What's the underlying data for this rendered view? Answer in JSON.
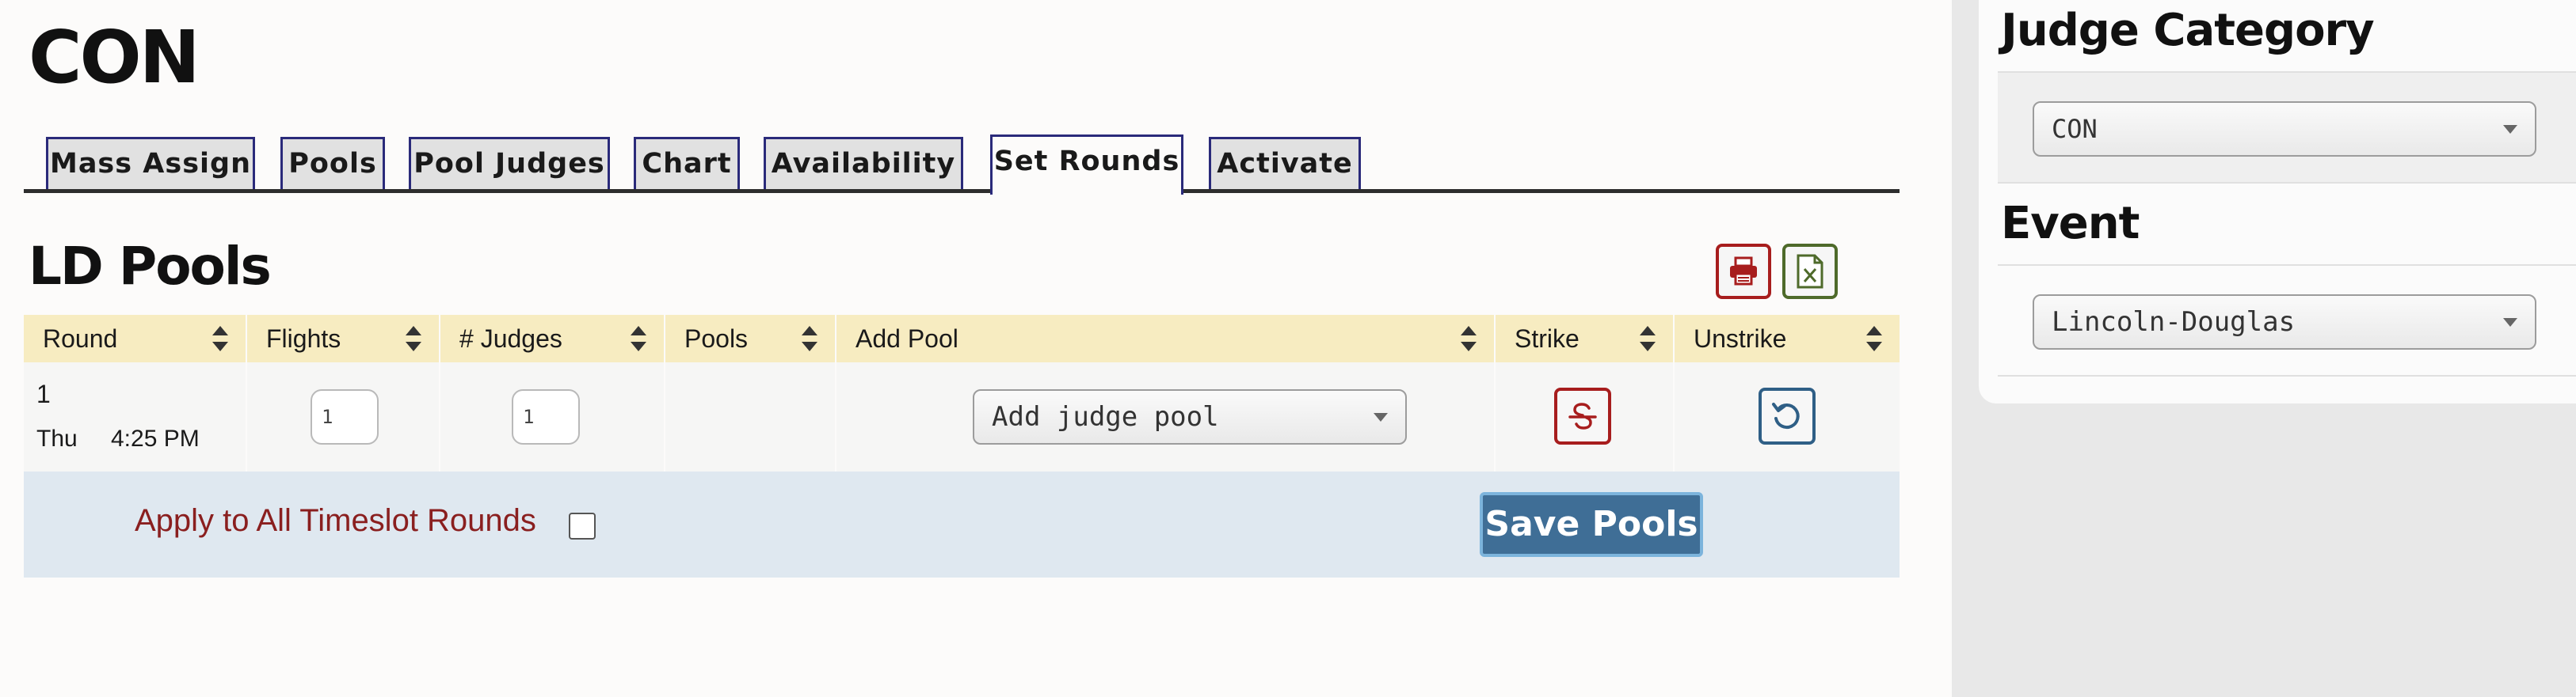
{
  "page": {
    "title": "CON"
  },
  "tabs": [
    {
      "label": "Mass Assign",
      "active": false
    },
    {
      "label": "Pools",
      "active": false
    },
    {
      "label": "Pool Judges",
      "active": false
    },
    {
      "label": "Chart",
      "active": false
    },
    {
      "label": "Availability",
      "active": false
    },
    {
      "label": "Set Rounds",
      "active": true
    },
    {
      "label": "Activate",
      "active": false
    }
  ],
  "section": {
    "title": "LD Pools",
    "actions": {
      "print_icon": "printer-icon",
      "excel_icon": "excel-file-icon"
    }
  },
  "table": {
    "columns": [
      "Round",
      "Flights",
      "# Judges",
      "Pools",
      "Add Pool",
      "Strike",
      "Unstrike"
    ],
    "rows": [
      {
        "round": "1",
        "day": "Thu",
        "time": "4:25 PM",
        "flights": "1",
        "judges": "1",
        "pools": "",
        "add_pool_placeholder": "Add judge pool",
        "strike_icon": "strikethrough-icon",
        "unstrike_icon": "undo-icon"
      }
    ]
  },
  "footer": {
    "apply_label": "Apply to All Timeslot Rounds",
    "apply_checked": false,
    "save_label": "Save Pools"
  },
  "sidebar": {
    "judge_category": {
      "heading": "Judge Category",
      "selected": "CON"
    },
    "event": {
      "heading": "Event",
      "selected": "Lincoln-Douglas"
    }
  },
  "colors": {
    "header_bg": "#f7ecc1",
    "footer_bg": "#dfe8f0",
    "accent_red": "#a71d1d",
    "accent_green": "#4e6a2a",
    "accent_blue": "#3f6e96",
    "apply_text": "#8a1f1f"
  }
}
